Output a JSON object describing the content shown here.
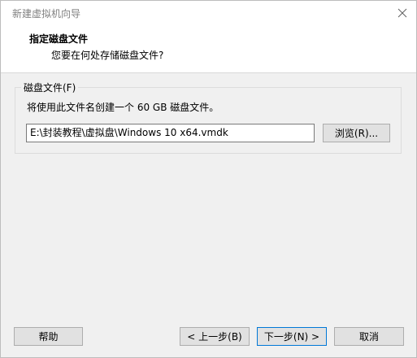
{
  "window": {
    "title": "新建虚拟机向导",
    "close_icon": "close-icon"
  },
  "header": {
    "title": "指定磁盘文件",
    "subtitle": "您要在何处存储磁盘文件?"
  },
  "disk_file": {
    "group_label": "磁盘文件(F)",
    "description": "将使用此文件名创建一个 60 GB 磁盘文件。",
    "path_value": "E:\\封装教程\\虚拟盘\\Windows 10 x64.vmdk",
    "browse_label": "浏览(R)..."
  },
  "footer": {
    "help_label": "帮助",
    "back_label": "< 上一步(B)",
    "next_label": "下一步(N) >",
    "cancel_label": "取消"
  }
}
